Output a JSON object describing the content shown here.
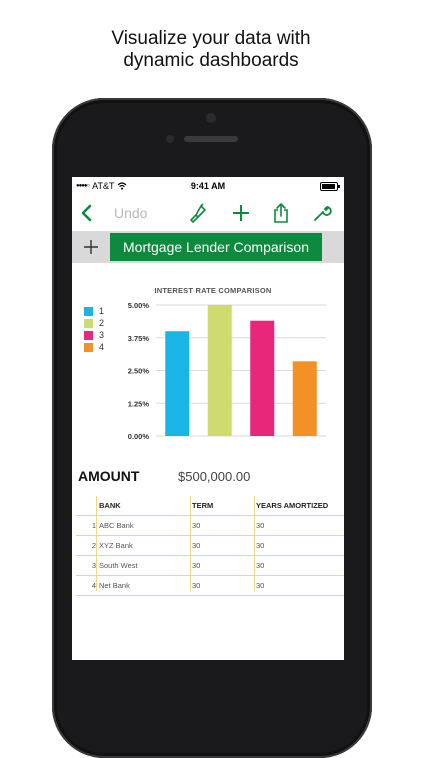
{
  "headline": {
    "line1": "Visualize your data with",
    "line2": "dynamic dashboards"
  },
  "status_bar": {
    "carrier": "AT&T",
    "time": "9:41 AM",
    "battery_level": 0.9
  },
  "toolbar": {
    "undo_label": "Undo",
    "icons": [
      "back-chevron-icon",
      "paintbrush-icon",
      "plus-icon",
      "share-icon",
      "wrench-icon"
    ]
  },
  "tabs": {
    "active_sheet": "Mortgage Lender Comparison"
  },
  "colors": {
    "accent": "#0d8a3d",
    "series1": "#19b6e5",
    "series2": "#cfdb6e",
    "series3": "#e8267a",
    "series4": "#f39026"
  },
  "chart_data": {
    "type": "bar",
    "title": "INTEREST RATE COMPARISON",
    "categories": [
      "1",
      "2",
      "3",
      "4"
    ],
    "values": [
      4.0,
      5.0,
      4.4,
      2.85
    ],
    "y_ticks": [
      "5.00%",
      "3.75%",
      "2.50%",
      "1.25%",
      "0.00%"
    ],
    "ylim": [
      0,
      5
    ],
    "legend": [
      "1",
      "2",
      "3",
      "4"
    ],
    "legend_position": "left",
    "grid": true
  },
  "amount": {
    "label": "AMOUNT",
    "value": "$500,000.00"
  },
  "table": {
    "headers": [
      "BANK",
      "TERM",
      "YEARS AMORTIZED"
    ],
    "rows": [
      {
        "num": "1",
        "bank": "ABC Bank",
        "term": "30",
        "years": "30"
      },
      {
        "num": "2",
        "bank": "XYZ Bank",
        "term": "30",
        "years": "30"
      },
      {
        "num": "3",
        "bank": "South West",
        "term": "30",
        "years": "30"
      },
      {
        "num": "4",
        "bank": "Net Bank",
        "term": "30",
        "years": "30"
      }
    ]
  }
}
